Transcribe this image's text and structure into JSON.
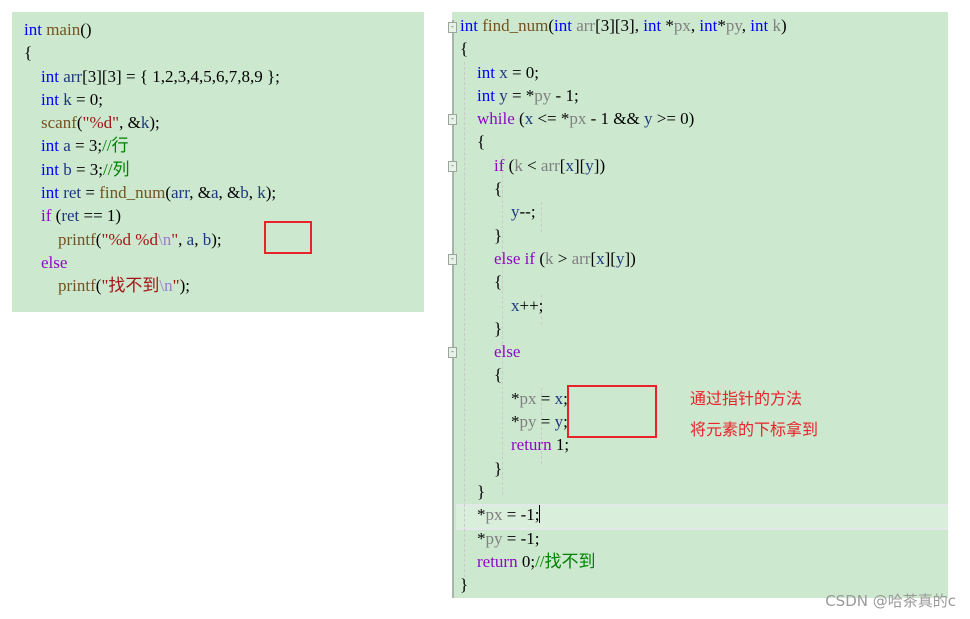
{
  "left_code": {
    "lines": [
      [
        {
          "t": "int",
          "c": "kw"
        },
        {
          "t": " main",
          "c": "fn"
        },
        {
          "t": "()",
          "c": "plain"
        }
      ],
      [
        {
          "t": "{",
          "c": "plain"
        }
      ],
      [
        {
          "t": "    int",
          "c": "kw"
        },
        {
          "t": " arr",
          "c": "var"
        },
        {
          "t": "[3][3] = { 1,2,3,4,5,6,7,8,9 };",
          "c": "plain"
        }
      ],
      [
        {
          "t": "    int",
          "c": "kw"
        },
        {
          "t": " k",
          "c": "var"
        },
        {
          "t": " = 0;",
          "c": "plain"
        }
      ],
      [
        {
          "t": "    scanf",
          "c": "fn"
        },
        {
          "t": "(",
          "c": "plain"
        },
        {
          "t": "\"%d\"",
          "c": "str"
        },
        {
          "t": ", &",
          "c": "plain"
        },
        {
          "t": "k",
          "c": "var"
        },
        {
          "t": ");",
          "c": "plain"
        }
      ],
      [
        {
          "t": "    int",
          "c": "kw"
        },
        {
          "t": " a",
          "c": "var"
        },
        {
          "t": " = 3;",
          "c": "plain"
        },
        {
          "t": "//行",
          "c": "cm"
        }
      ],
      [
        {
          "t": "    int",
          "c": "kw"
        },
        {
          "t": " b",
          "c": "var"
        },
        {
          "t": " = 3;",
          "c": "plain"
        },
        {
          "t": "//列",
          "c": "cm"
        }
      ],
      [
        {
          "t": "    int",
          "c": "kw"
        },
        {
          "t": " ret",
          "c": "var"
        },
        {
          "t": " = ",
          "c": "plain"
        },
        {
          "t": "find_num",
          "c": "fn"
        },
        {
          "t": "(",
          "c": "plain"
        },
        {
          "t": "arr",
          "c": "var"
        },
        {
          "t": ", &",
          "c": "plain"
        },
        {
          "t": "a",
          "c": "var"
        },
        {
          "t": ", &",
          "c": "plain"
        },
        {
          "t": "b",
          "c": "var"
        },
        {
          "t": ", ",
          "c": "plain"
        },
        {
          "t": "k",
          "c": "var"
        },
        {
          "t": ");",
          "c": "plain"
        }
      ],
      [
        {
          "t": "    if",
          "c": "ctl"
        },
        {
          "t": " (",
          "c": "plain"
        },
        {
          "t": "ret",
          "c": "var"
        },
        {
          "t": " == 1)",
          "c": "plain"
        }
      ],
      [
        {
          "t": "        printf",
          "c": "fn"
        },
        {
          "t": "(",
          "c": "plain"
        },
        {
          "t": "\"%d %d",
          "c": "str"
        },
        {
          "t": "\\n",
          "c": "esc"
        },
        {
          "t": "\"",
          "c": "str"
        },
        {
          "t": ", ",
          "c": "plain"
        },
        {
          "t": "a",
          "c": "var"
        },
        {
          "t": ", ",
          "c": "plain"
        },
        {
          "t": "b",
          "c": "var"
        },
        {
          "t": ");",
          "c": "plain"
        }
      ],
      [
        {
          "t": "    else",
          "c": "ctl"
        }
      ],
      [
        {
          "t": "        printf",
          "c": "fn"
        },
        {
          "t": "(",
          "c": "plain"
        },
        {
          "t": "\"找不到",
          "c": "str"
        },
        {
          "t": "\\n",
          "c": "esc"
        },
        {
          "t": "\"",
          "c": "str"
        },
        {
          "t": ");",
          "c": "plain"
        }
      ]
    ]
  },
  "right_code": {
    "lines": [
      [
        {
          "t": "int",
          "c": "kw"
        },
        {
          "t": " find_num",
          "c": "fn"
        },
        {
          "t": "(",
          "c": "plain"
        },
        {
          "t": "int",
          "c": "kw"
        },
        {
          "t": " arr",
          "c": "param"
        },
        {
          "t": "[3][3], ",
          "c": "plain"
        },
        {
          "t": "int",
          "c": "kw"
        },
        {
          "t": " *",
          "c": "plain"
        },
        {
          "t": "px",
          "c": "param"
        },
        {
          "t": ", ",
          "c": "plain"
        },
        {
          "t": "int",
          "c": "kw"
        },
        {
          "t": "*",
          "c": "plain"
        },
        {
          "t": "py",
          "c": "param"
        },
        {
          "t": ", ",
          "c": "plain"
        },
        {
          "t": "int",
          "c": "kw"
        },
        {
          "t": " k",
          "c": "param"
        },
        {
          "t": ")",
          "c": "plain"
        }
      ],
      [
        {
          "t": "{",
          "c": "plain"
        }
      ],
      [
        {
          "t": "    int",
          "c": "kw"
        },
        {
          "t": " x",
          "c": "var"
        },
        {
          "t": " = 0;",
          "c": "plain"
        }
      ],
      [
        {
          "t": "    int",
          "c": "kw"
        },
        {
          "t": " y",
          "c": "var"
        },
        {
          "t": " = *",
          "c": "plain"
        },
        {
          "t": "py",
          "c": "param"
        },
        {
          "t": " - 1;",
          "c": "plain"
        }
      ],
      [
        {
          "t": "    while",
          "c": "ctl"
        },
        {
          "t": " (",
          "c": "plain"
        },
        {
          "t": "x",
          "c": "var"
        },
        {
          "t": " <= *",
          "c": "plain"
        },
        {
          "t": "px",
          "c": "param"
        },
        {
          "t": " - 1 && ",
          "c": "plain"
        },
        {
          "t": "y",
          "c": "var"
        },
        {
          "t": " >= 0)",
          "c": "plain"
        }
      ],
      [
        {
          "t": "    {",
          "c": "plain"
        }
      ],
      [
        {
          "t": "        if",
          "c": "ctl"
        },
        {
          "t": " (",
          "c": "plain"
        },
        {
          "t": "k",
          "c": "param"
        },
        {
          "t": " < ",
          "c": "plain"
        },
        {
          "t": "arr",
          "c": "param"
        },
        {
          "t": "[",
          "c": "plain"
        },
        {
          "t": "x",
          "c": "var"
        },
        {
          "t": "][",
          "c": "plain"
        },
        {
          "t": "y",
          "c": "var"
        },
        {
          "t": "])",
          "c": "plain"
        }
      ],
      [
        {
          "t": "        {",
          "c": "plain"
        }
      ],
      [
        {
          "t": "            y",
          "c": "var"
        },
        {
          "t": "--;",
          "c": "plain"
        }
      ],
      [
        {
          "t": "        }",
          "c": "plain"
        }
      ],
      [
        {
          "t": "        else if",
          "c": "ctl"
        },
        {
          "t": " (",
          "c": "plain"
        },
        {
          "t": "k",
          "c": "param"
        },
        {
          "t": " > ",
          "c": "plain"
        },
        {
          "t": "arr",
          "c": "param"
        },
        {
          "t": "[",
          "c": "plain"
        },
        {
          "t": "x",
          "c": "var"
        },
        {
          "t": "][",
          "c": "plain"
        },
        {
          "t": "y",
          "c": "var"
        },
        {
          "t": "])",
          "c": "plain"
        }
      ],
      [
        {
          "t": "        {",
          "c": "plain"
        }
      ],
      [
        {
          "t": "            x",
          "c": "var"
        },
        {
          "t": "++;",
          "c": "plain"
        }
      ],
      [
        {
          "t": "        }",
          "c": "plain"
        }
      ],
      [
        {
          "t": "        else",
          "c": "ctl"
        }
      ],
      [
        {
          "t": "        {",
          "c": "plain"
        }
      ],
      [
        {
          "t": "            *",
          "c": "plain"
        },
        {
          "t": "px",
          "c": "param"
        },
        {
          "t": " = ",
          "c": "plain"
        },
        {
          "t": "x",
          "c": "var"
        },
        {
          "t": ";",
          "c": "plain"
        }
      ],
      [
        {
          "t": "            *",
          "c": "plain"
        },
        {
          "t": "py",
          "c": "param"
        },
        {
          "t": " = ",
          "c": "plain"
        },
        {
          "t": "y",
          "c": "var"
        },
        {
          "t": ";",
          "c": "plain"
        }
      ],
      [
        {
          "t": "            return",
          "c": "ctl"
        },
        {
          "t": " 1;",
          "c": "plain"
        }
      ],
      [
        {
          "t": "        }",
          "c": "plain"
        }
      ],
      [
        {
          "t": "    }",
          "c": "plain"
        }
      ],
      [
        {
          "t": "    *",
          "c": "plain"
        },
        {
          "t": "px",
          "c": "param"
        },
        {
          "t": " = -1;",
          "c": "plain"
        }
      ],
      [
        {
          "t": "    *",
          "c": "plain"
        },
        {
          "t": "py",
          "c": "param"
        },
        {
          "t": " = -1;",
          "c": "plain"
        }
      ],
      [
        {
          "t": "    return",
          "c": "ctl"
        },
        {
          "t": " 0;",
          "c": "plain"
        },
        {
          "t": "//找不到",
          "c": "cm"
        }
      ],
      [
        {
          "t": "}",
          "c": "plain"
        }
      ]
    ]
  },
  "annotation": {
    "line1": "通过指针的方法",
    "line2": "将元素的下标拿到"
  },
  "watermark": "CSDN @哈茶真的c",
  "colors": {
    "panel_bg": "#cce8cf",
    "highlight_box": "#e8232a",
    "keyword": "#0000ff",
    "control": "#8f08c4",
    "comment": "#008000",
    "string": "#a31515"
  }
}
